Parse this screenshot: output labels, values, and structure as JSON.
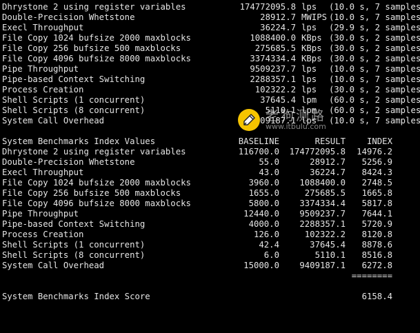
{
  "results": [
    {
      "name": "Dhrystone 2 using register variables",
      "value": "174772095.8",
      "unit": "lps",
      "samples": "(10.0 s, 7 samples)"
    },
    {
      "name": "Double-Precision Whetstone",
      "value": "28912.7",
      "unit": "MWIPS",
      "samples": "(10.0 s, 7 samples)"
    },
    {
      "name": "Execl Throughput",
      "value": "36224.7",
      "unit": "lps",
      "samples": "(29.9 s, 2 samples)"
    },
    {
      "name": "File Copy 1024 bufsize 2000 maxblocks",
      "value": "1088400.0",
      "unit": "KBps",
      "samples": "(30.0 s, 2 samples)"
    },
    {
      "name": "File Copy 256 bufsize 500 maxblocks",
      "value": "275685.5",
      "unit": "KBps",
      "samples": "(30.0 s, 2 samples)"
    },
    {
      "name": "File Copy 4096 bufsize 8000 maxblocks",
      "value": "3374334.4",
      "unit": "KBps",
      "samples": "(30.0 s, 2 samples)"
    },
    {
      "name": "Pipe Throughput",
      "value": "9509237.7",
      "unit": "lps",
      "samples": "(10.0 s, 7 samples)"
    },
    {
      "name": "Pipe-based Context Switching",
      "value": "2288357.1",
      "unit": "lps",
      "samples": "(10.0 s, 7 samples)"
    },
    {
      "name": "Process Creation",
      "value": "102322.2",
      "unit": "lps",
      "samples": "(30.0 s, 2 samples)"
    },
    {
      "name": "Shell Scripts (1 concurrent)",
      "value": "37645.4",
      "unit": "lpm",
      "samples": "(60.0 s, 2 samples)"
    },
    {
      "name": "Shell Scripts (8 concurrent)",
      "value": "5110.1",
      "unit": "lpm",
      "samples": "(60.0 s, 2 samples)"
    },
    {
      "name": "System Call Overhead",
      "value": "9409187.1",
      "unit": "lps",
      "samples": "(10.0 s, 7 samples)"
    }
  ],
  "index": {
    "title": "System Benchmarks Index Values",
    "headers": {
      "baseline": "BASELINE",
      "result": "RESULT",
      "index": "INDEX"
    },
    "rows": [
      {
        "name": "Dhrystone 2 using register variables",
        "baseline": "116700.0",
        "result": "174772095.8",
        "index": "14976.2"
      },
      {
        "name": "Double-Precision Whetstone",
        "baseline": "55.0",
        "result": "28912.7",
        "index": "5256.9"
      },
      {
        "name": "Execl Throughput",
        "baseline": "43.0",
        "result": "36224.7",
        "index": "8424.3"
      },
      {
        "name": "File Copy 1024 bufsize 2000 maxblocks",
        "baseline": "3960.0",
        "result": "1088400.0",
        "index": "2748.5"
      },
      {
        "name": "File Copy 256 bufsize 500 maxblocks",
        "baseline": "1655.0",
        "result": "275685.5",
        "index": "1665.8"
      },
      {
        "name": "File Copy 4096 bufsize 8000 maxblocks",
        "baseline": "5800.0",
        "result": "3374334.4",
        "index": "5817.8"
      },
      {
        "name": "Pipe Throughput",
        "baseline": "12440.0",
        "result": "9509237.7",
        "index": "7644.1"
      },
      {
        "name": "Pipe-based Context Switching",
        "baseline": "4000.0",
        "result": "2288357.1",
        "index": "5720.9"
      },
      {
        "name": "Process Creation",
        "baseline": "126.0",
        "result": "102322.2",
        "index": "8120.8"
      },
      {
        "name": "Shell Scripts (1 concurrent)",
        "baseline": "42.4",
        "result": "37645.4",
        "index": "8878.6"
      },
      {
        "name": "Shell Scripts (8 concurrent)",
        "baseline": "6.0",
        "result": "5110.1",
        "index": "8516.8"
      },
      {
        "name": "System Call Overhead",
        "baseline": "15000.0",
        "result": "9409187.1",
        "index": "6272.8"
      }
    ],
    "separator": "========",
    "score_label": "System Benchmarks Index Score",
    "score": "6158.4"
  },
  "watermark": {
    "text_cn": "老狗测路",
    "url": "www.itbulu.com",
    "logo_color": "#f5c400"
  }
}
